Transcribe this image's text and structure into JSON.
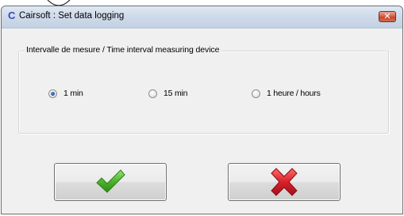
{
  "window": {
    "title": "Cairsoft : Set data logging",
    "app_icon_glyph": "C",
    "close_glyph": "✕"
  },
  "group": {
    "label": "Intervalle de mesure / Time interval measuring device"
  },
  "interval_options": [
    {
      "label": "1 min",
      "checked": true
    },
    {
      "label": "15 min",
      "checked": false
    },
    {
      "label": "1 heure / hours",
      "checked": false
    }
  ],
  "buttons": {
    "ok_icon": "check-icon",
    "cancel_icon": "red-x-icon"
  },
  "colors": {
    "check_green": "#4cb52e",
    "cancel_red": "#d8202a",
    "close_button": "#c8452a",
    "titlebar": "#cdd9e8"
  }
}
